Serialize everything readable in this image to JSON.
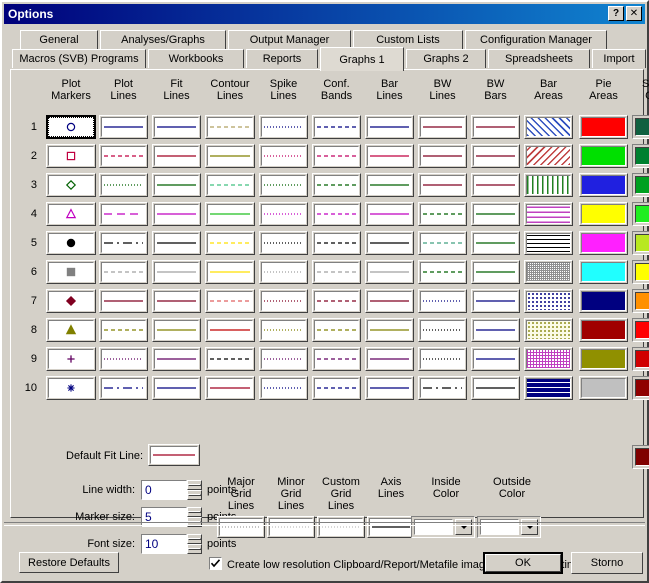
{
  "window": {
    "title": "Options",
    "help_button": "?",
    "close_button": "✕"
  },
  "tabs": {
    "row1": [
      {
        "label": "General",
        "active": false
      },
      {
        "label": "Analyses/Graphs",
        "active": false
      },
      {
        "label": "Output Manager",
        "active": false
      },
      {
        "label": "Custom Lists",
        "active": false
      },
      {
        "label": "Configuration Manager",
        "active": false
      }
    ],
    "row2": [
      {
        "label": "Macros (SVB) Programs",
        "active": false
      },
      {
        "label": "Workbooks",
        "active": false
      },
      {
        "label": "Reports",
        "active": false
      },
      {
        "label": "Graphs 1",
        "active": true
      },
      {
        "label": "Graphs 2",
        "active": false
      },
      {
        "label": "Spreadsheets",
        "active": false
      },
      {
        "label": "Import",
        "active": false
      }
    ]
  },
  "grid": {
    "columns": [
      {
        "name": "plot-markers",
        "line1": "Plot",
        "line2": "Markers"
      },
      {
        "name": "plot-lines",
        "line1": "Plot",
        "line2": "Lines"
      },
      {
        "name": "fit-lines",
        "line1": "Fit",
        "line2": "Lines"
      },
      {
        "name": "contour-lines",
        "line1": "Contour",
        "line2": "Lines"
      },
      {
        "name": "spike-lines",
        "line1": "Spike",
        "line2": "Lines"
      },
      {
        "name": "conf-bands",
        "line1": "Conf.",
        "line2": "Bands"
      },
      {
        "name": "bar-lines",
        "line1": "Bar",
        "line2": "Lines"
      },
      {
        "name": "bw-lines",
        "line1": "BW",
        "line2": "Lines"
      },
      {
        "name": "bw-bars",
        "line1": "BW",
        "line2": "Bars"
      },
      {
        "name": "bar-areas",
        "line1": "Bar",
        "line2": "Areas"
      },
      {
        "name": "pie-areas",
        "line1": "Pie",
        "line2": "Areas"
      },
      {
        "name": "surface-colors",
        "line1": "Surface",
        "line2": "Colors"
      }
    ],
    "row_labels": [
      "1",
      "2",
      "3",
      "4",
      "5",
      "6",
      "7",
      "8",
      "9",
      "10"
    ],
    "plot_markers": [
      {
        "shape": "circle-open",
        "color": "#000080"
      },
      {
        "shape": "square-open",
        "color": "#c00040"
      },
      {
        "shape": "diamond-open",
        "color": "#006000"
      },
      {
        "shape": "triangle-open",
        "color": "#c000c0"
      },
      {
        "shape": "circle-fill",
        "color": "#000000"
      },
      {
        "shape": "square-fill",
        "color": "#808080"
      },
      {
        "shape": "diamond-fill",
        "color": "#800020"
      },
      {
        "shape": "triangle-fill",
        "color": "#808000"
      },
      {
        "shape": "plus",
        "color": "#600060"
      },
      {
        "shape": "asterisk",
        "color": "#000080"
      }
    ],
    "plot_lines": [
      {
        "style": "solid",
        "color": "#000080"
      },
      {
        "style": "dashed",
        "color": "#c00040"
      },
      {
        "style": "dotted",
        "color": "#006000"
      },
      {
        "style": "dashed-long",
        "color": "#c000c0"
      },
      {
        "style": "dash-dot",
        "color": "#000000"
      },
      {
        "style": "dashed",
        "color": "#a0a0a0"
      },
      {
        "style": "solid",
        "color": "#800020"
      },
      {
        "style": "dashed",
        "color": "#808000"
      },
      {
        "style": "dotted",
        "color": "#600060"
      },
      {
        "style": "dash-dot",
        "color": "#000080"
      }
    ],
    "fit_lines": [
      {
        "style": "solid",
        "color": "#000080"
      },
      {
        "style": "solid",
        "color": "#a00020"
      },
      {
        "style": "solid",
        "color": "#006000"
      },
      {
        "style": "solid",
        "color": "#c000c0"
      },
      {
        "style": "solid",
        "color": "#000000"
      },
      {
        "style": "solid",
        "color": "#a0a0a0"
      },
      {
        "style": "solid",
        "color": "#800020"
      },
      {
        "style": "solid",
        "color": "#808000"
      },
      {
        "style": "solid",
        "color": "#600060"
      },
      {
        "style": "solid",
        "color": "#000080"
      }
    ],
    "contour_lines": [
      {
        "style": "dashed",
        "color": "#b0a060"
      },
      {
        "style": "solid",
        "color": "#808000"
      },
      {
        "style": "dashed",
        "color": "#40c080"
      },
      {
        "style": "solid",
        "color": "#20c020"
      },
      {
        "style": "dashed",
        "color": "#ffe000"
      },
      {
        "style": "solid",
        "color": "#ffe000"
      },
      {
        "style": "dashed",
        "color": "#e06060"
      },
      {
        "style": "solid",
        "color": "#c00000"
      },
      {
        "style": "dashed",
        "color": "#000000"
      },
      {
        "style": "solid",
        "color": "#a00020"
      }
    ],
    "spike_lines": [
      {
        "style": "dotted",
        "color": "#000080"
      },
      {
        "style": "dotted",
        "color": "#c00060"
      },
      {
        "style": "dotted",
        "color": "#006000"
      },
      {
        "style": "dotted",
        "color": "#c000c0"
      },
      {
        "style": "dotted",
        "color": "#000000"
      },
      {
        "style": "dotted",
        "color": "#a0a0a0"
      },
      {
        "style": "dotted",
        "color": "#800020"
      },
      {
        "style": "dotted",
        "color": "#808000"
      },
      {
        "style": "dotted",
        "color": "#600060"
      },
      {
        "style": "dotted",
        "color": "#000080"
      }
    ],
    "conf_bands": [
      {
        "style": "dashed",
        "color": "#000080"
      },
      {
        "style": "dashed",
        "color": "#c00060"
      },
      {
        "style": "dashed",
        "color": "#006000"
      },
      {
        "style": "dashed",
        "color": "#c000c0"
      },
      {
        "style": "dashed",
        "color": "#000000"
      },
      {
        "style": "dashed",
        "color": "#a0a0a0"
      },
      {
        "style": "dashed",
        "color": "#800020"
      },
      {
        "style": "dashed",
        "color": "#808000"
      },
      {
        "style": "dashed",
        "color": "#600060"
      },
      {
        "style": "dashed",
        "color": "#000080"
      }
    ],
    "bar_lines": [
      {
        "style": "solid",
        "color": "#000080"
      },
      {
        "style": "solid",
        "color": "#c00040"
      },
      {
        "style": "solid",
        "color": "#006000"
      },
      {
        "style": "solid",
        "color": "#c000c0"
      },
      {
        "style": "solid",
        "color": "#000000"
      },
      {
        "style": "solid",
        "color": "#a0a0a0"
      },
      {
        "style": "solid",
        "color": "#800020"
      },
      {
        "style": "solid",
        "color": "#808000"
      },
      {
        "style": "solid",
        "color": "#600060"
      },
      {
        "style": "solid",
        "color": "#000080"
      }
    ],
    "bw_lines": [
      {
        "style": "solid",
        "color": "#800020"
      },
      {
        "style": "solid",
        "color": "#800020"
      },
      {
        "style": "solid",
        "color": "#800020"
      },
      {
        "style": "dashed",
        "color": "#006000"
      },
      {
        "style": "dashed",
        "color": "#40a080"
      },
      {
        "style": "dashed",
        "color": "#006000"
      },
      {
        "style": "dotted",
        "color": "#000080"
      },
      {
        "style": "dotted",
        "color": "#000000"
      },
      {
        "style": "dotted",
        "color": "#000000"
      },
      {
        "style": "dash-dot",
        "color": "#000000"
      }
    ],
    "bw_bars": [
      {
        "style": "solid",
        "color": "#800020"
      },
      {
        "style": "solid",
        "color": "#800020"
      },
      {
        "style": "solid",
        "color": "#800020"
      },
      {
        "style": "solid",
        "color": "#006000"
      },
      {
        "style": "solid",
        "color": "#006000"
      },
      {
        "style": "solid",
        "color": "#006000"
      },
      {
        "style": "solid",
        "color": "#000080"
      },
      {
        "style": "solid",
        "color": "#000080"
      },
      {
        "style": "solid",
        "color": "#000080"
      },
      {
        "style": "solid",
        "color": "#000000"
      }
    ],
    "bar_areas": [
      {
        "pattern": "diag-fwd",
        "color": "#3050c0",
        "bg": "#ffffff"
      },
      {
        "pattern": "diag-back",
        "color": "#c04040",
        "bg": "#ffffff"
      },
      {
        "pattern": "vertical",
        "color": "#208020",
        "bg": "#ffffff"
      },
      {
        "pattern": "horizontal",
        "color": "#c040c0",
        "bg": "#ffffff"
      },
      {
        "pattern": "grid",
        "color": "#000000",
        "bg": "#ffffff"
      },
      {
        "pattern": "fine-check",
        "color": "#909090",
        "bg": "#ffffff"
      },
      {
        "pattern": "dots",
        "color": "#000080",
        "bg": "#ffffff"
      },
      {
        "pattern": "dots",
        "color": "#909020",
        "bg": "#fbfbe8"
      },
      {
        "pattern": "check",
        "color": "#c040c0",
        "bg": "#ffffff"
      },
      {
        "pattern": "brick",
        "color": "#000080",
        "bg": "#ffffff"
      }
    ],
    "pie_areas": [
      "#ff0000",
      "#00e000",
      "#2020e0",
      "#ffff00",
      "#ff20ff",
      "#20ffff",
      "#000080",
      "#a00000",
      "#909000",
      "#c0c0c0"
    ],
    "surface_colors": [
      "#106040",
      "#008030",
      "#00a020",
      "#20ee20",
      "#b8e820",
      "#ffff00",
      "#ff9000",
      "#ff0000",
      "#d00000",
      "#900000",
      "#800000"
    ]
  },
  "controls": {
    "default_fit_line_label": "Default Fit Line:",
    "default_fit_line_color": "#a00020",
    "line_width_label": "Line width:",
    "line_width_value": "0",
    "marker_size_label": "Marker size:",
    "marker_size_value": "5",
    "font_size_label": "Font size:",
    "font_size_value": "10",
    "points_unit": "points",
    "groups": [
      {
        "name": "major-grid-lines",
        "l1": "Major",
        "l2": "Grid",
        "l3": "Lines",
        "preview": "dotted",
        "color": "#a0a0a0"
      },
      {
        "name": "minor-grid-lines",
        "l1": "Minor",
        "l2": "Grid",
        "l3": "Lines",
        "preview": "dotted",
        "color": "#c0c0c0"
      },
      {
        "name": "custom-grid-lines",
        "l1": "Custom",
        "l2": "Grid",
        "l3": "Lines",
        "preview": "dotted",
        "color": "#c0c0c0"
      },
      {
        "name": "axis-lines",
        "l1": "Axis",
        "l2": "Lines",
        "l3": "",
        "preview": "solid",
        "color": "#000000"
      }
    ],
    "inside_color_label_1": "Inside",
    "inside_color_label_2": "Color",
    "inside_color_value": "#ffffff",
    "outside_color_label_1": "Outside",
    "outside_color_label_2": "Color",
    "outside_color_value": "#ffffff",
    "restore_defaults_label": "Restore Defaults",
    "checkbox_label": "Create low resolution Clipboard/Report/Metafile images (best for printing)",
    "checkbox_checked": true
  },
  "footer": {
    "ok_label": "OK",
    "cancel_label": "Storno"
  }
}
